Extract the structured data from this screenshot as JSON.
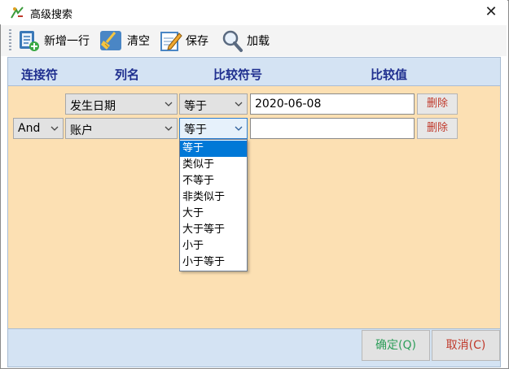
{
  "window": {
    "title": "高级搜索"
  },
  "toolbar": {
    "add_row": "新增一行",
    "clear": "清空",
    "save": "保存",
    "load": "加载"
  },
  "columns": {
    "connector": "连接符",
    "column_name": "列名",
    "operator": "比较符号",
    "value": "比较值"
  },
  "rows": [
    {
      "connector": "",
      "column": "发生日期",
      "operator": "等于",
      "value": "2020-06-08",
      "delete": "删除"
    },
    {
      "connector": "And",
      "column": "账户",
      "operator": "等于",
      "value": "",
      "delete": "删除"
    }
  ],
  "operator_dropdown": {
    "options": [
      "等于",
      "类似于",
      "不等于",
      "非类似于",
      "大于",
      "大于等于",
      "小于",
      "小于等于"
    ],
    "selected": "等于"
  },
  "footer": {
    "ok": "确定(Q)",
    "cancel": "取消(C)",
    "ok_color": "#2e9e5a",
    "cancel_color": "#c0392b"
  }
}
